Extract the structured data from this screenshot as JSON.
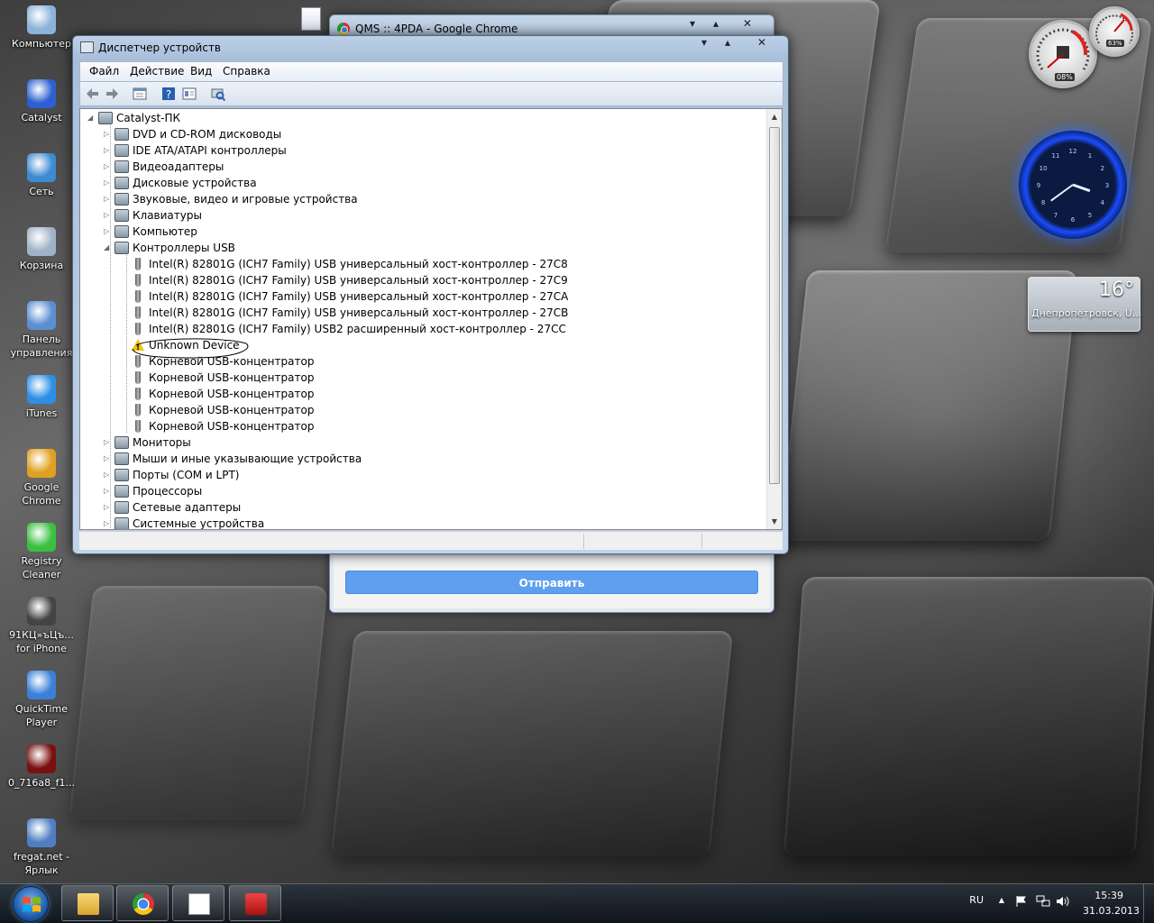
{
  "desktop": {
    "icons": [
      {
        "label": "Компьютер",
        "icon": "computer-icon",
        "color": "#8bb3d9"
      },
      {
        "label": "Catalyst",
        "icon": "catalyst-icon",
        "color": "#2c5fd0"
      },
      {
        "label": "Сеть",
        "icon": "network-icon",
        "color": "#3d8ad0"
      },
      {
        "label": "Корзина",
        "icon": "recycle-bin-icon",
        "color": "#9fb3c8"
      },
      {
        "label": "Панель\nуправления",
        "icon": "control-panel-icon",
        "color": "#5b8fd3"
      },
      {
        "label": "iTunes",
        "icon": "itunes-icon",
        "color": "#2d8ee6"
      },
      {
        "label": "Google\nChrome",
        "icon": "chrome-icon",
        "color": "#e0a020"
      },
      {
        "label": "Registry\nCleaner",
        "icon": "registry-cleaner-icon",
        "color": "#3ac040"
      },
      {
        "label": "91КЦ»ъЦъ...\nfor iPhone",
        "icon": "iphone-app-icon",
        "color": "#444444"
      },
      {
        "label": "QuickTime\nPlayer",
        "icon": "quicktime-icon",
        "color": "#3b7fd9"
      },
      {
        "label": "0_716a8_f1...",
        "icon": "image-file-icon",
        "color": "#7a1010"
      },
      {
        "label": "fregat.net -\nЯрлык",
        "icon": "shortcut-network-icon",
        "color": "#4f7ec2"
      }
    ]
  },
  "chrome_window": {
    "title": "QMS :: 4PDA - Google Chrome",
    "send_button": "Отправить"
  },
  "device_manager": {
    "title": "Диспетчер устройств",
    "menu": [
      "Файл",
      "Действие",
      "Вид",
      "Справка"
    ],
    "tree": [
      {
        "label": "Catalyst-ПК",
        "level": 0,
        "expanded": true,
        "icon": "computer-icon"
      },
      {
        "label": "DVD и CD-ROM дисководы",
        "level": 1,
        "icon": "dvd-drive-icon"
      },
      {
        "label": "IDE ATA/ATAPI контроллеры",
        "level": 1,
        "icon": "ide-controller-icon"
      },
      {
        "label": "Видеоадаптеры",
        "level": 1,
        "icon": "display-adapter-icon"
      },
      {
        "label": "Дисковые устройства",
        "level": 1,
        "icon": "disk-drive-icon"
      },
      {
        "label": "Звуковые, видео и игровые устройства",
        "level": 1,
        "icon": "sound-icon"
      },
      {
        "label": "Клавиатуры",
        "level": 1,
        "icon": "keyboard-icon"
      },
      {
        "label": "Компьютер",
        "level": 1,
        "icon": "computer-icon"
      },
      {
        "label": "Контроллеры USB",
        "level": 1,
        "expanded": true,
        "icon": "usb-icon"
      },
      {
        "label": "Intel(R) 82801G (ICH7 Family) USB универсальный хост-контроллер  - 27C8",
        "level": 2,
        "icon": "usb-plug-icon"
      },
      {
        "label": "Intel(R) 82801G (ICH7 Family) USB универсальный хост-контроллер  - 27C9",
        "level": 2,
        "icon": "usb-plug-icon"
      },
      {
        "label": "Intel(R) 82801G (ICH7 Family) USB универсальный хост-контроллер  - 27CA",
        "level": 2,
        "icon": "usb-plug-icon"
      },
      {
        "label": "Intel(R) 82801G (ICH7 Family) USB универсальный хост-контроллер  - 27CB",
        "level": 2,
        "icon": "usb-plug-icon"
      },
      {
        "label": "Intel(R) 82801G (ICH7 Family) USB2 расширенный хост-контроллер  - 27CC",
        "level": 2,
        "icon": "usb-plug-icon"
      },
      {
        "label": "Unknown Device",
        "level": 2,
        "icon": "warning-icon",
        "circled": true
      },
      {
        "label": "Корневой USB-концентратор",
        "level": 2,
        "icon": "usb-plug-icon"
      },
      {
        "label": "Корневой USB-концентратор",
        "level": 2,
        "icon": "usb-plug-icon"
      },
      {
        "label": "Корневой USB-концентратор",
        "level": 2,
        "icon": "usb-plug-icon"
      },
      {
        "label": "Корневой USB-концентратор",
        "level": 2,
        "icon": "usb-plug-icon"
      },
      {
        "label": "Корневой USB-концентратор",
        "level": 2,
        "icon": "usb-plug-icon"
      },
      {
        "label": "Мониторы",
        "level": 1,
        "icon": "monitor-icon"
      },
      {
        "label": "Мыши и иные указывающие устройства",
        "level": 1,
        "icon": "mouse-icon"
      },
      {
        "label": "Порты (COM и LPT)",
        "level": 1,
        "icon": "port-icon"
      },
      {
        "label": "Процессоры",
        "level": 1,
        "icon": "processor-icon"
      },
      {
        "label": "Сетевые адаптеры",
        "level": 1,
        "icon": "network-adapter-icon"
      },
      {
        "label": "Системные устройства",
        "level": 1,
        "icon": "system-devices-icon"
      }
    ]
  },
  "gadgets": {
    "cpu_percent": "08%",
    "memory_percent": "63%",
    "clock_numbers": [
      "12",
      "1",
      "2",
      "3",
      "4",
      "5",
      "6",
      "7",
      "8",
      "9",
      "10",
      "11"
    ],
    "clock_time": {
      "hour": 3,
      "minute": 39
    },
    "weather_temp": "16°",
    "weather_city": "Днепропетровск, U..."
  },
  "taskbar": {
    "language": "RU",
    "time": "15:39",
    "date": "31.03.2013"
  }
}
